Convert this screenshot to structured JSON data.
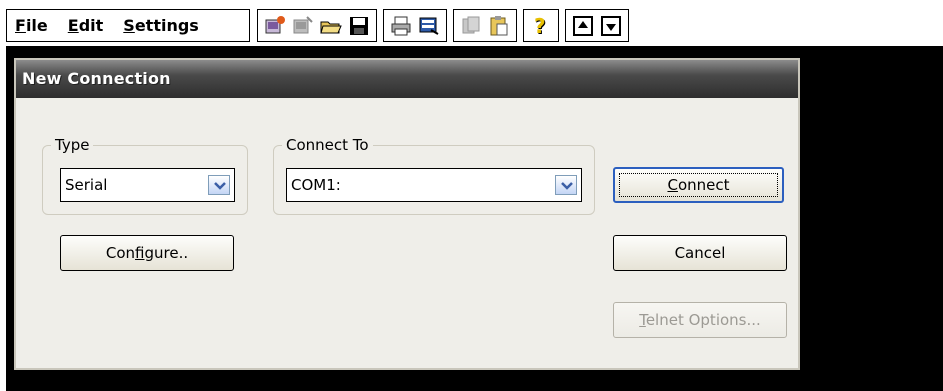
{
  "menu": {
    "file": {
      "key": "F",
      "rest": "ile"
    },
    "edit": {
      "key": "E",
      "rest": "dit"
    },
    "settings": {
      "key": "S",
      "rest": "ettings"
    }
  },
  "toolbar": {
    "icons": [
      "new-connection-icon",
      "disconnect-icon",
      "open-folder-icon",
      "save-disk-icon",
      "print-icon",
      "print-setup-icon",
      "copy-icon",
      "paste-icon",
      "help-icon",
      "scroll-up-icon",
      "scroll-down-icon"
    ]
  },
  "dialog": {
    "title": "New Connection",
    "type_group": {
      "label": "Type",
      "value": "Serial"
    },
    "connect_group": {
      "label": "Connect To",
      "value": "COM1:"
    },
    "buttons": {
      "configure": {
        "pre": "Con",
        "key": "f",
        "post": "igure.."
      },
      "connect": {
        "key": "C",
        "post": "onnect"
      },
      "cancel": "Cancel",
      "telnet": {
        "key": "T",
        "post": "elnet Options..."
      }
    }
  }
}
